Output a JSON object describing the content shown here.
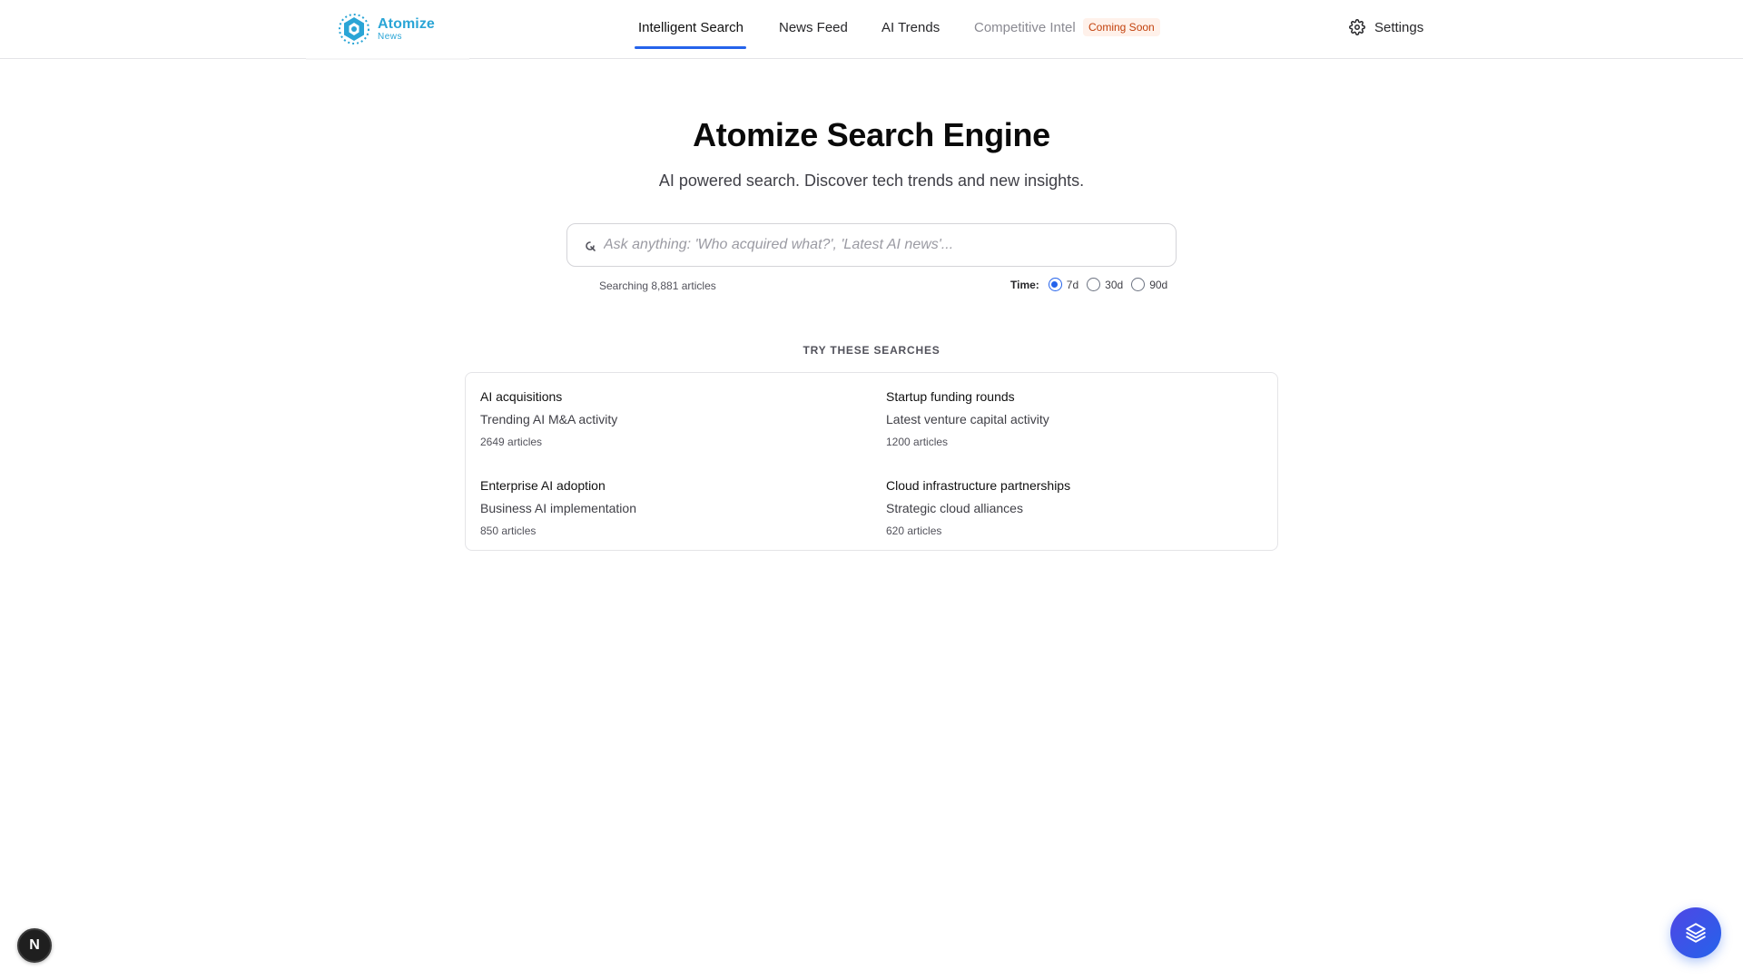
{
  "brand": {
    "name": "Atomize",
    "sub": "News",
    "color": "#2aa5d6"
  },
  "nav": {
    "items": [
      {
        "label": "Intelligent Search"
      },
      {
        "label": "News Feed"
      },
      {
        "label": "AI Trends"
      },
      {
        "label": "Competitive Intel"
      }
    ],
    "badge": "Coming Soon",
    "settings_label": "Settings"
  },
  "hero": {
    "title": "Atomize Search Engine",
    "subtitle": "AI powered search. Discover tech trends and new insights."
  },
  "search": {
    "placeholder": "Ask anything: 'Who acquired what?', 'Latest AI news'...",
    "value": "",
    "meta": "Searching 8,881 articles",
    "time_label": "Time:",
    "time_options": [
      "7d",
      "30d",
      "90d"
    ],
    "time_selected": "7d"
  },
  "suggestions": {
    "heading": "TRY THESE SEARCHES",
    "items": [
      {
        "title": "AI acquisitions",
        "desc": "Trending AI M&A activity",
        "count": "2649 articles"
      },
      {
        "title": "Startup funding rounds",
        "desc": "Latest venture capital activity",
        "count": "1200 articles"
      },
      {
        "title": "Enterprise AI adoption",
        "desc": "Business AI implementation",
        "count": "850 articles"
      },
      {
        "title": "Cloud infrastructure partnerships",
        "desc": "Strategic cloud alliances",
        "count": "620 articles"
      }
    ]
  },
  "floating": {
    "dev_badge": "N"
  },
  "colors": {
    "accent": "#2563eb",
    "badge_text": "#c2410c",
    "badge_bg": "#fff1ea"
  }
}
